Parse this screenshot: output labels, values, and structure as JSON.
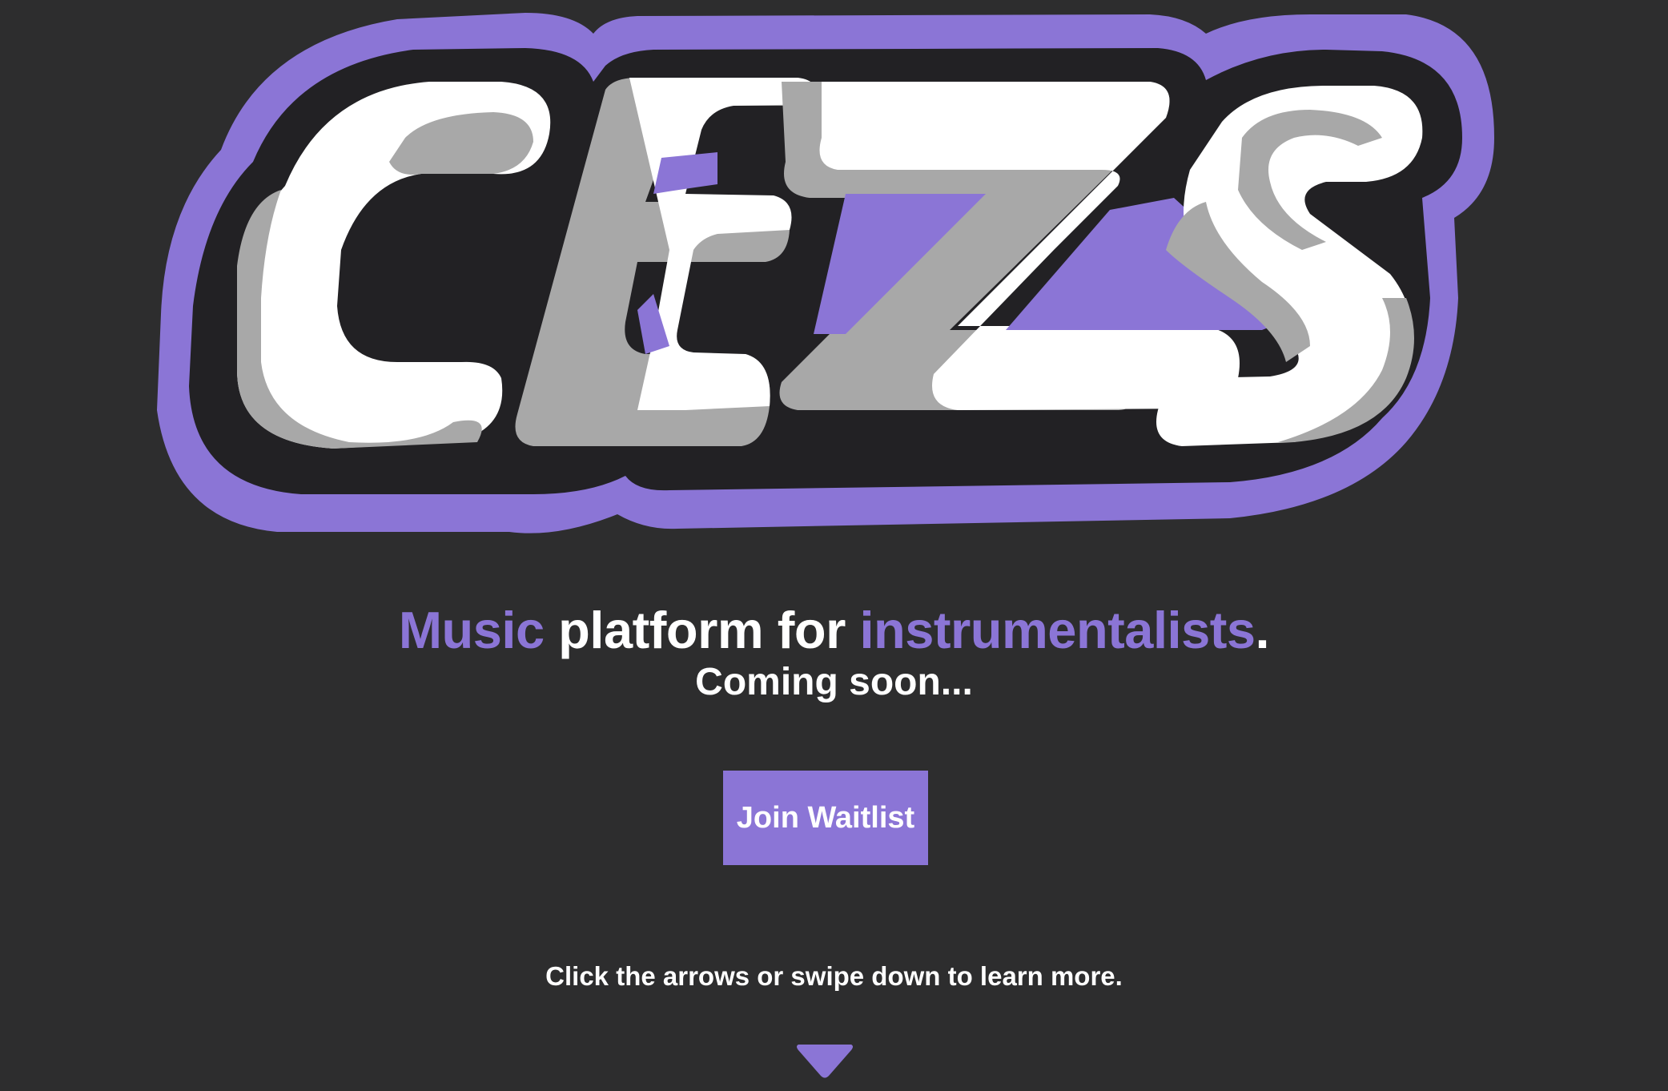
{
  "logo": {
    "text": "CEZS",
    "colors": {
      "outer": "#8b75d6",
      "outline": "#222124",
      "fill": "#ffffff",
      "shadow": "#a8a8a8",
      "inner": "#8b75d6"
    }
  },
  "hero": {
    "tagline_word1": "Music",
    "tagline_mid": " platform for ",
    "tagline_word2": "instrumentalists",
    "tagline_end": ".",
    "subtitle": "Coming soon..."
  },
  "cta": {
    "join_label": "Join Waitlist"
  },
  "footer": {
    "hint": "Click the arrows or swipe down to learn more.",
    "arrow_icon": "triangle-down-icon"
  },
  "colors": {
    "background": "#2d2d2e",
    "accent": "#8b75d6",
    "text": "#ffffff"
  }
}
